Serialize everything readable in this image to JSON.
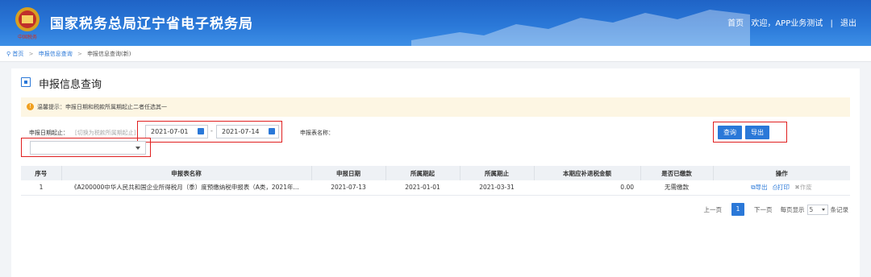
{
  "header": {
    "site_title": "国家税务总局辽宁省电子税务局",
    "links": [
      "首页",
      "欢迎，APP业务测试",
      "|",
      "退出"
    ]
  },
  "breadcrumb": [
    "首页",
    "申报信息查询",
    "申报信息查询(新)"
  ],
  "panel": {
    "title": "申报信息查询",
    "tip": "温馨提示：申报日期和税款所属期起止二者任选其一",
    "date_label": "申报日期起止：",
    "date_hint": "[切换为税款所属期起止]",
    "date_from": "2021-07-01",
    "date_to": "2021-07-14",
    "dash": "-",
    "form_label": "申报表名称：",
    "form_select_value": "",
    "query_button": "查询",
    "export_button": "导出"
  },
  "table": {
    "columns": [
      "序号",
      "申报表名称",
      "申报日期",
      "所属期起",
      "所属期止",
      "本期应补退税金额",
      "是否已缴款",
      "操作"
    ],
    "rows": [
      {
        "index": "1",
        "name": "《A200000中华人民共和国企业所得税月（季）度预缴纳税申报表（A类，2021年...",
        "report_date": "2021-07-13",
        "period_start": "2021-01-01",
        "period_end": "2021-03-31",
        "amount": "0.00",
        "paid": "无需缴款",
        "ops": [
          "导出",
          "打印",
          "作废"
        ]
      }
    ]
  },
  "pager": {
    "prev": "上一页",
    "current": "1",
    "next": "下一页",
    "per_page_label": "每页显示",
    "per_page": "5",
    "suffix": "条记录"
  }
}
